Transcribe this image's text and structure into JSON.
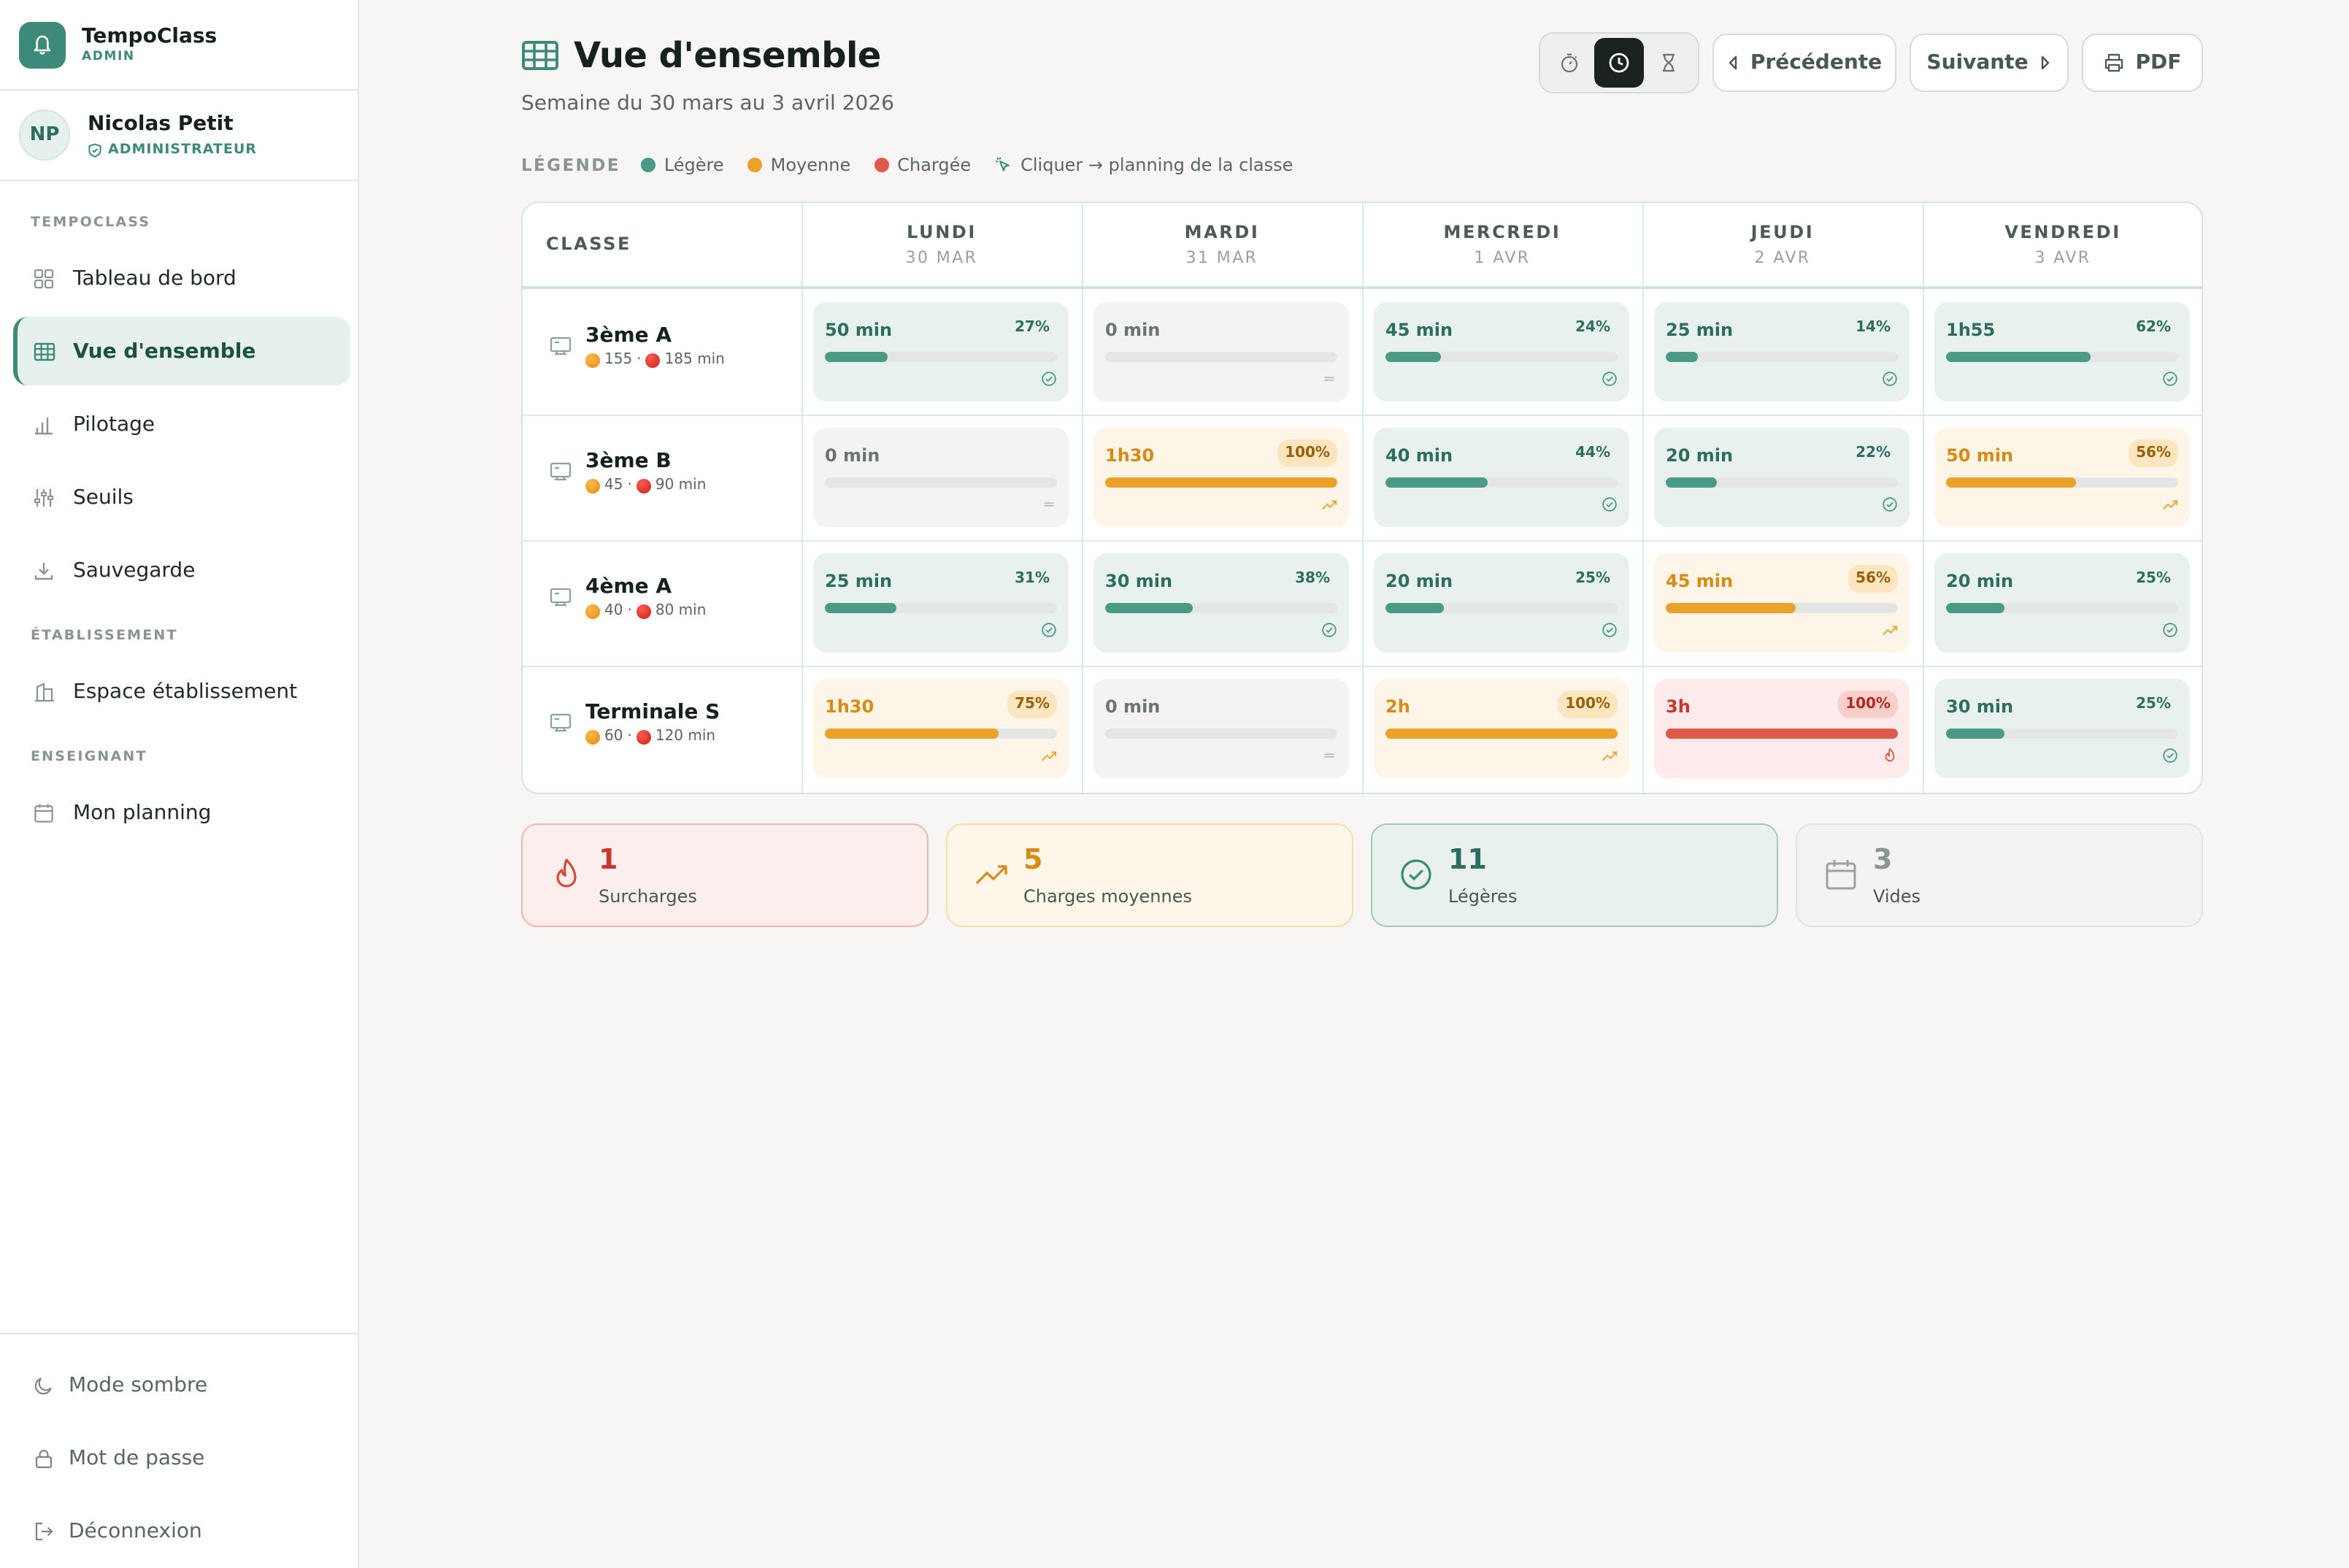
{
  "brand": {
    "name": "TempoClass",
    "role": "ADMIN",
    "logo_icon": "bell-icon"
  },
  "user": {
    "initials": "NP",
    "name": "Nicolas Petit",
    "role": "ADMINISTRATEUR"
  },
  "nav": {
    "section1": "TEMPOCLASS",
    "section2": "ÉTABLISSEMENT",
    "section3": "ENSEIGNANT",
    "items": [
      {
        "label": "Tableau de bord",
        "icon": "grid-icon"
      },
      {
        "label": "Vue d'ensemble",
        "icon": "table-icon",
        "active": true
      },
      {
        "label": "Pilotage",
        "icon": "bar-chart-icon"
      },
      {
        "label": "Seuils",
        "icon": "sliders-icon"
      },
      {
        "label": "Sauvegarde",
        "icon": "download-icon"
      },
      {
        "label": "Espace établissement",
        "icon": "building-icon"
      },
      {
        "label": "Mon planning",
        "icon": "calendar-icon"
      }
    ],
    "bottom": [
      {
        "label": "Mode sombre",
        "icon": "moon-icon"
      },
      {
        "label": "Mot de passe",
        "icon": "lock-icon"
      },
      {
        "label": "Déconnexion",
        "icon": "logout-icon"
      }
    ]
  },
  "header": {
    "title": "Vue d'ensemble",
    "subtitle": "Semaine du 30 mars au 3 avril 2026",
    "prev": "Précédente",
    "next": "Suivante",
    "pdf": "PDF",
    "view_modes": [
      "stopwatch-icon",
      "clock-icon",
      "hourglass-icon"
    ],
    "active_mode": 1
  },
  "legend": {
    "title": "LÉGENDE",
    "light": "Légère",
    "medium": "Moyenne",
    "heavy": "Chargée",
    "hint": "Cliquer → planning de la classe"
  },
  "colors": {
    "light": "#4a9a86",
    "medium": "#eca22a",
    "heavy": "#e0584a",
    "empty": "#d5d8d6"
  },
  "table": {
    "class_header": "CLASSE",
    "days": [
      {
        "name": "LUNDI",
        "date": "30 MAR"
      },
      {
        "name": "MARDI",
        "date": "31 MAR"
      },
      {
        "name": "MERCREDI",
        "date": "1 AVR"
      },
      {
        "name": "JEUDI",
        "date": "2 AVR"
      },
      {
        "name": "VENDREDI",
        "date": "3 AVR"
      }
    ],
    "rows": [
      {
        "name": "3ème A",
        "orange": "155",
        "red": "185 min",
        "cells": [
          {
            "val": "50 min",
            "pct": "27%",
            "level": "light",
            "fill": 0.27
          },
          {
            "val": "0 min",
            "pct": "",
            "level": "empty",
            "fill": 0
          },
          {
            "val": "45 min",
            "pct": "24%",
            "level": "light",
            "fill": 0.24
          },
          {
            "val": "25 min",
            "pct": "14%",
            "level": "light",
            "fill": 0.14
          },
          {
            "val": "1h55",
            "pct": "62%",
            "level": "light",
            "fill": 0.62
          }
        ]
      },
      {
        "name": "3ème B",
        "orange": "45",
        "red": "90 min",
        "cells": [
          {
            "val": "0 min",
            "pct": "",
            "level": "empty",
            "fill": 0
          },
          {
            "val": "1h30",
            "pct": "100%",
            "level": "medium",
            "fill": 1.0
          },
          {
            "val": "40 min",
            "pct": "44%",
            "level": "light",
            "fill": 0.44
          },
          {
            "val": "20 min",
            "pct": "22%",
            "level": "light",
            "fill": 0.22
          },
          {
            "val": "50 min",
            "pct": "56%",
            "level": "medium",
            "fill": 0.56
          }
        ]
      },
      {
        "name": "4ème A",
        "orange": "40",
        "red": "80 min",
        "cells": [
          {
            "val": "25 min",
            "pct": "31%",
            "level": "light",
            "fill": 0.31
          },
          {
            "val": "30 min",
            "pct": "38%",
            "level": "light",
            "fill": 0.38
          },
          {
            "val": "20 min",
            "pct": "25%",
            "level": "light",
            "fill": 0.25
          },
          {
            "val": "45 min",
            "pct": "56%",
            "level": "medium",
            "fill": 0.56
          },
          {
            "val": "20 min",
            "pct": "25%",
            "level": "light",
            "fill": 0.25
          }
        ]
      },
      {
        "name": "Terminale S",
        "orange": "60",
        "red": "120 min",
        "cells": [
          {
            "val": "1h30",
            "pct": "75%",
            "level": "medium",
            "fill": 0.75
          },
          {
            "val": "0 min",
            "pct": "",
            "level": "empty",
            "fill": 0
          },
          {
            "val": "2h",
            "pct": "100%",
            "level": "medium",
            "fill": 1.0
          },
          {
            "val": "3h",
            "pct": "100%",
            "level": "heavy",
            "fill": 1.0
          },
          {
            "val": "30 min",
            "pct": "25%",
            "level": "light",
            "fill": 0.25
          }
        ]
      }
    ]
  },
  "summary": [
    {
      "num": "1",
      "label": "Surcharges",
      "kind": "heavy",
      "icon": "flame-icon"
    },
    {
      "num": "5",
      "label": "Charges moyennes",
      "kind": "medium",
      "icon": "trending-up-icon"
    },
    {
      "num": "11",
      "label": "Légères",
      "kind": "light",
      "icon": "check-circle-icon"
    },
    {
      "num": "3",
      "label": "Vides",
      "kind": "empty",
      "icon": "calendar-icon"
    }
  ]
}
